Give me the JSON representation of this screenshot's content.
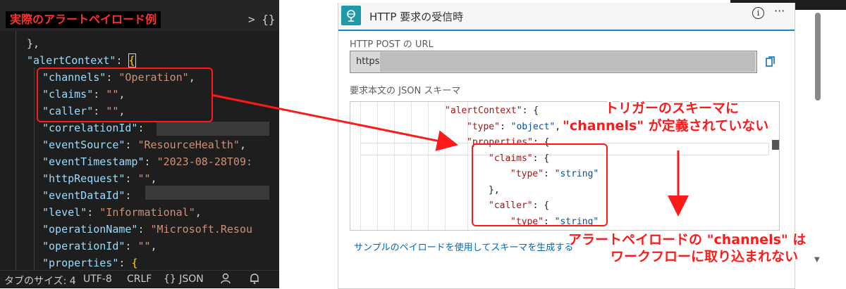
{
  "editor": {
    "title_label": "実際のアラートペイロード例",
    "title_chevron": "> {}",
    "lines": [
      {
        "key": "",
        "colon": "},",
        "value": "",
        "trail": ""
      },
      {
        "key": "\"alertContext\"",
        "colon": ": ",
        "value": "",
        "trail": "{"
      },
      {
        "key": "\"channels\"",
        "colon": ": ",
        "value": "\"Operation\"",
        "trail": ","
      },
      {
        "key": "\"claims\"",
        "colon": ": ",
        "value": "\"\"",
        "trail": ","
      },
      {
        "key": "\"caller\"",
        "colon": ": ",
        "value": "\"\"",
        "trail": ","
      },
      {
        "key": "\"correlationId\"",
        "colon": ": ",
        "value": "",
        "trail": ""
      },
      {
        "key": "\"eventSource\"",
        "colon": ": ",
        "value": "\"ResourceHealth\"",
        "trail": ","
      },
      {
        "key": "\"eventTimestamp\"",
        "colon": ": ",
        "value": "\"2023-08-28T09:",
        "trail": ""
      },
      {
        "key": "\"httpRequest\"",
        "colon": ": ",
        "value": "\"\"",
        "trail": ","
      },
      {
        "key": "\"eventDataId\"",
        "colon": ": ",
        "value": "",
        "trail": ""
      },
      {
        "key": "\"level\"",
        "colon": ": ",
        "value": "\"Informational\"",
        "trail": ","
      },
      {
        "key": "\"operationName\"",
        "colon": ": ",
        "value": "\"Microsoft.Resou",
        "trail": ""
      },
      {
        "key": "\"operationId\"",
        "colon": ": ",
        "value": "\"\"",
        "trail": ","
      },
      {
        "key": "\"properties\"",
        "colon": ": ",
        "value": "",
        "trail": "{"
      }
    ],
    "status": {
      "tab_size": "タブのサイズ: 4",
      "encoding": "UTF-8",
      "eol": "CRLF",
      "language": "{} JSON",
      "feedback_icon": "person-feedback-icon",
      "bell_icon": "bell-icon"
    }
  },
  "card": {
    "title": "HTTP 要求の受信時",
    "header_icon": "http-trigger-icon",
    "info_icon": "info-icon",
    "more_label": "···",
    "url_label": "HTTP POST の URL",
    "url_value": "https:",
    "copy_icon": "copy-icon",
    "schema_label": "要求本文の JSON スキーマ",
    "schema_lines": [
      {
        "indent": 0,
        "key": "\"alertContext\"",
        "colon": ": ",
        "value": "",
        "trail": "{"
      },
      {
        "indent": 1,
        "key": "\"type\"",
        "colon": ": ",
        "value": "\"object\"",
        "trail": ","
      },
      {
        "indent": 1,
        "key": "\"properties\"",
        "colon": ": ",
        "value": "",
        "trail": "{"
      },
      {
        "indent": 2,
        "key": "\"claims\"",
        "colon": ": ",
        "value": "",
        "trail": "{"
      },
      {
        "indent": 3,
        "key": "\"type\"",
        "colon": ": ",
        "value": "\"string\"",
        "trail": ""
      },
      {
        "indent": 2,
        "key": "",
        "colon": "},",
        "value": "",
        "trail": ""
      },
      {
        "indent": 2,
        "key": "\"caller\"",
        "colon": ": ",
        "value": "",
        "trail": "{"
      },
      {
        "indent": 3,
        "key": "\"type\"",
        "colon": ": ",
        "value": "\"string\"",
        "trail": ""
      },
      {
        "indent": 2,
        "key": "",
        "colon": "},",
        "value": "",
        "trail": ""
      }
    ],
    "generate_link": "サンプルのペイロードを使用してスキーマを生成する"
  },
  "annotations": {
    "top_line1": "トリガーのスキーマに",
    "top_line2": "\"channels\" が定義されていない",
    "bottom_line1": "アラートペイロードの \"channels\" は",
    "bottom_line2": "ワークフローに取り込まれない"
  },
  "colors": {
    "annotation_red": "#ff1a1a",
    "header_accent": "#1f85c7",
    "trigger_icon_bg": "#1f9aa6",
    "link_blue": "#0067b8"
  }
}
